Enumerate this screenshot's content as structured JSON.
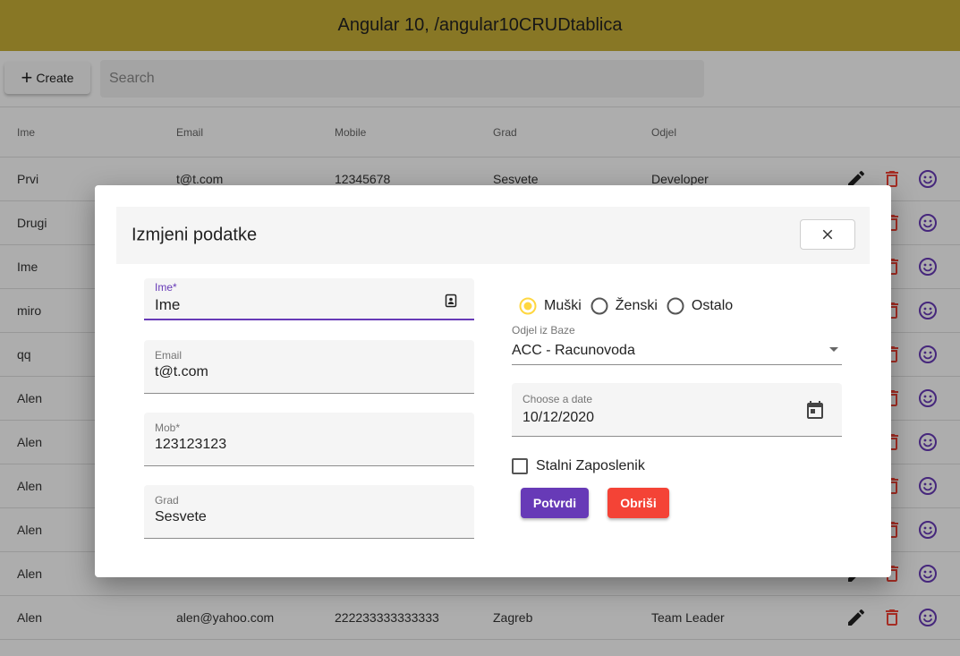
{
  "header": {
    "title": "Angular 10, /angular10CRUDtablica"
  },
  "toolbar": {
    "create_label": "Create",
    "search_placeholder": "Search"
  },
  "table": {
    "columns": [
      "Ime",
      "Email",
      "Mobile",
      "Grad",
      "Odjel"
    ],
    "rows": [
      {
        "ime": "Prvi",
        "email": "t@t.com",
        "mobile": "12345678",
        "grad": "Sesvete",
        "odjel": "Developer"
      },
      {
        "ime": "Drugi",
        "email": "",
        "mobile": "",
        "grad": "",
        "odjel": ""
      },
      {
        "ime": "Ime",
        "email": "",
        "mobile": "",
        "grad": "",
        "odjel": ""
      },
      {
        "ime": "miro",
        "email": "",
        "mobile": "",
        "grad": "",
        "odjel": ""
      },
      {
        "ime": "qq",
        "email": "",
        "mobile": "",
        "grad": "",
        "odjel": ""
      },
      {
        "ime": "Alen",
        "email": "",
        "mobile": "",
        "grad": "",
        "odjel": ""
      },
      {
        "ime": "Alen",
        "email": "",
        "mobile": "",
        "grad": "",
        "odjel": ""
      },
      {
        "ime": "Alen",
        "email": "",
        "mobile": "",
        "grad": "",
        "odjel": ""
      },
      {
        "ime": "Alen",
        "email": "",
        "mobile": "",
        "grad": "",
        "odjel": ""
      },
      {
        "ime": "Alen",
        "email": "",
        "mobile": "",
        "grad": "",
        "odjel": ""
      },
      {
        "ime": "Alen",
        "email": "alen@yahoo.com",
        "mobile": "222233333333333",
        "grad": "Zagreb",
        "odjel": "Team Leader"
      }
    ],
    "action_icons": [
      "edit-icon",
      "delete-icon",
      "mood-icon"
    ]
  },
  "dialog": {
    "title": "Izmjeni podatke",
    "fields": {
      "ime": {
        "label": "Ime*",
        "value": "Ime"
      },
      "email": {
        "label": "Email",
        "value": "t@t.com"
      },
      "mob": {
        "label": "Mob*",
        "value": "123123123"
      },
      "grad": {
        "label": "Grad",
        "value": "Sesvete"
      }
    },
    "gender": {
      "options": [
        "Muški",
        "Ženski",
        "Ostalo"
      ],
      "selected": "Muški"
    },
    "odjel": {
      "label": "Odjel iz Baze",
      "value": "ACC - Racunovoda"
    },
    "date": {
      "label": "Choose a date",
      "value": "10/12/2020"
    },
    "stalni": {
      "label": "Stalni Zaposlenik",
      "checked": false
    },
    "submit_label": "Potvrdi",
    "clear_label": "Obriši"
  },
  "colors": {
    "header": "#c9b037",
    "primary": "#673ab7",
    "warn": "#f44336",
    "accent": "#ffd740"
  }
}
